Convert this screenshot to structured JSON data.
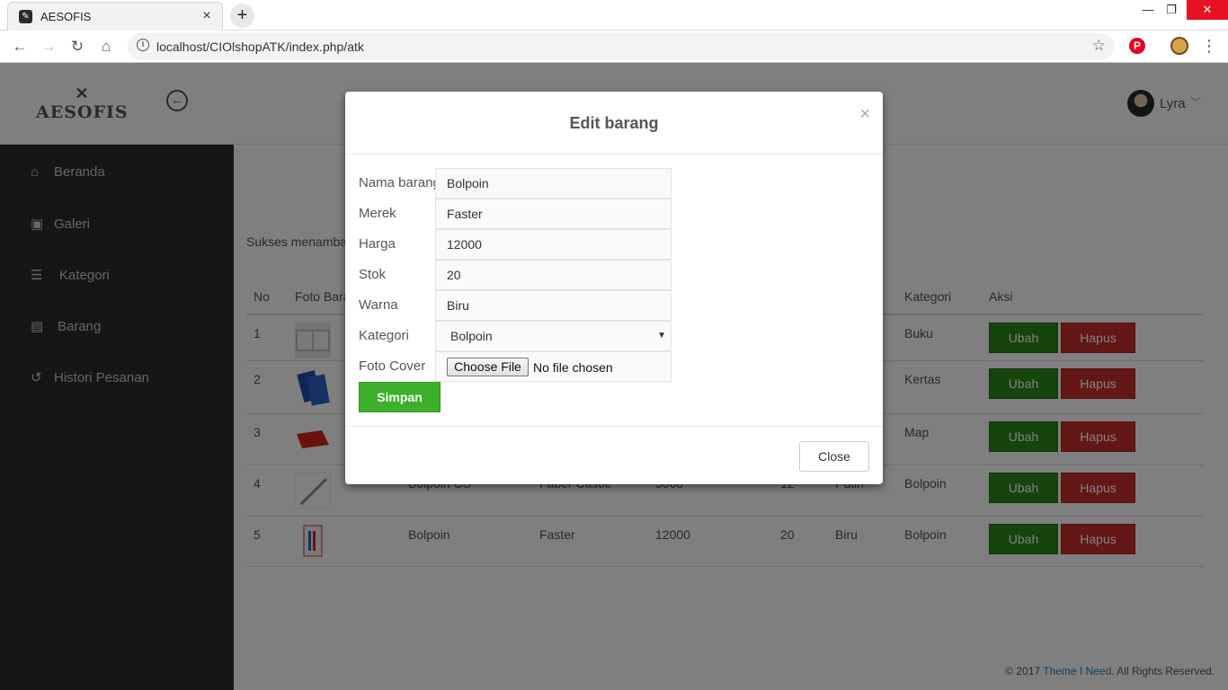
{
  "browser": {
    "tab_title": "AESOFIS",
    "url": "localhost/CIOlshopATK/index.php/atk",
    "tab_close": "×",
    "new_tab": "+"
  },
  "header": {
    "logo_mark": "✕",
    "logo_text": "AESOFIS",
    "user_name": "Lyra"
  },
  "sidebar": {
    "items": [
      {
        "label": "Beranda",
        "icon": "home-icon"
      },
      {
        "label": "Galeri",
        "icon": "image-icon"
      },
      {
        "label": "Kategori",
        "icon": "list-icon"
      },
      {
        "label": "Barang",
        "icon": "list-alt-icon"
      },
      {
        "label": "Histori Pesanan",
        "icon": "history-icon"
      }
    ]
  },
  "main": {
    "success_message": "Sukses menambah",
    "table": {
      "headers": [
        "No",
        "Foto Barang",
        "",
        "",
        "",
        "",
        "",
        "Kategori",
        "Aksi"
      ],
      "rows": [
        {
          "no": "1",
          "nama": "",
          "merek": "",
          "harga": "",
          "stok": "",
          "warna": "",
          "kategori": "Buku"
        },
        {
          "no": "2",
          "nama": "",
          "merek": "",
          "harga": "",
          "stok": "",
          "warna": "",
          "kategori": "Kertas"
        },
        {
          "no": "3",
          "nama": "",
          "merek": "",
          "harga": "",
          "stok": "",
          "warna": "",
          "kategori": "Map"
        },
        {
          "no": "4",
          "nama": "Bolpoin CS",
          "merek": "Faber Castle",
          "harga": "5000",
          "stok": "12",
          "warna": "Putih",
          "kategori": "Bolpoin"
        },
        {
          "no": "5",
          "nama": "Bolpoin",
          "merek": "Faster",
          "harga": "12000",
          "stok": "20",
          "warna": "Biru",
          "kategori": "Bolpoin"
        }
      ],
      "ubah_label": "Ubah",
      "hapus_label": "Hapus"
    },
    "footer": {
      "prefix": "© 2017 ",
      "link": "Theme I Need",
      "suffix": ". All Rights Reserved."
    }
  },
  "modal": {
    "title": "Edit barang",
    "close_x": "×",
    "fields": {
      "nama_label": "Nama barang",
      "nama_value": "Bolpoin",
      "merek_label": "Merek",
      "merek_value": "Faster",
      "harga_label": "Harga",
      "harga_value": "12000",
      "stok_label": "Stok",
      "stok_value": "20",
      "warna_label": "Warna",
      "warna_value": "Biru",
      "kategori_label": "Kategori",
      "kategori_value": "Bolpoin",
      "foto_label": "Foto Cover",
      "file_button": "Choose File",
      "file_status": "No file chosen"
    },
    "submit_label": "Simpan",
    "close_label": "Close"
  },
  "colors": {
    "sidebar_bg": "#2a2c31",
    "ubah_green": "#2b8a1a",
    "hapus_red": "#c9302c",
    "simpan_green": "#3cb02a",
    "link_blue": "#337ab7"
  }
}
